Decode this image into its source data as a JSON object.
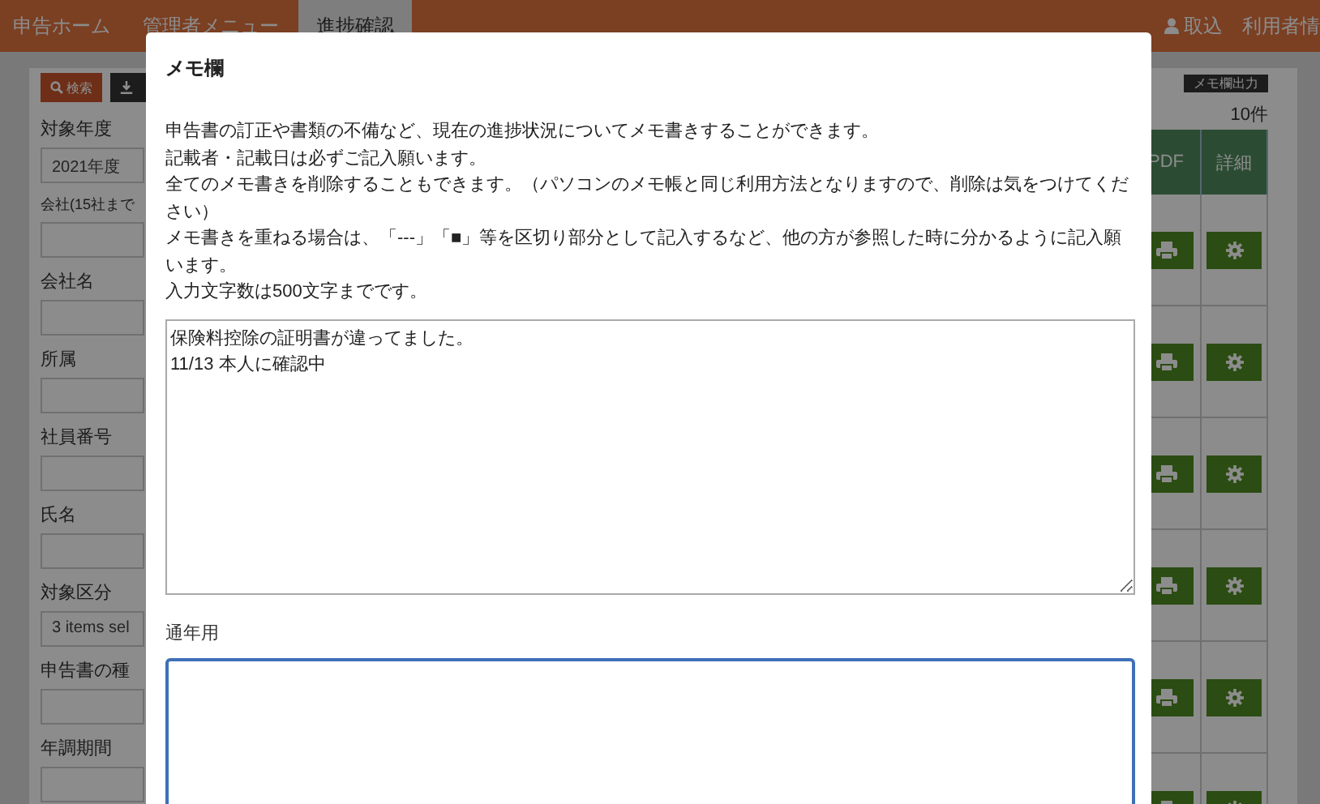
{
  "nav": {
    "items": [
      {
        "label": "申告ホーム",
        "selected": false
      },
      {
        "label": "管理者メニュー",
        "selected": false
      },
      {
        "label": "進捗確認",
        "selected": true
      }
    ],
    "right": [
      {
        "kind": "user",
        "label": "取込"
      },
      {
        "kind": "plain",
        "label": "利用者情"
      }
    ]
  },
  "toolbar": {
    "search_button": "検索",
    "export_button": "メモ欄出力",
    "count": "10件"
  },
  "filters": [
    {
      "label": "対象年度",
      "value": "2021年度"
    },
    {
      "label": "会社(15社まで"
    },
    {
      "label": "会社名"
    },
    {
      "label": "所属"
    },
    {
      "label": "社員番号"
    },
    {
      "label": "氏名"
    },
    {
      "label": "対象区分",
      "value": "3 items sel"
    },
    {
      "label": "申告書の種"
    },
    {
      "label": "年調期間"
    }
  ],
  "table": {
    "columns": [
      "PDF",
      "詳細"
    ],
    "rows": [
      {
        "kind": "actions"
      },
      {
        "kind": "actions"
      },
      {
        "kind": "actions"
      },
      {
        "kind": "actions"
      },
      {
        "kind": "actions"
      },
      {
        "kind": "actions"
      }
    ]
  },
  "modal": {
    "title": "メモ欄",
    "instructions": [
      "申告書の訂正や書類の不備など、現在の進捗状況についてメモ書きすることができます。",
      "記載者・記載日は必ずご記入願います。",
      "全てのメモ書きを削除することもできます。（パソコンのメモ帳と同じ利用方法となりますので、削除は気をつけてください）",
      "メモ書きを重ねる場合は、「---」「■」等を区切り部分として記入するなど、他の方が参照した時に分かるように記入願います。",
      "入力文字数は500文字までです。"
    ],
    "memo_field": {
      "value": "保険料控除の証明書が違ってました。\n11/13 本人に確認中",
      "focused": false
    },
    "yearly_field": {
      "label": "通年用",
      "focused": true
    }
  }
}
